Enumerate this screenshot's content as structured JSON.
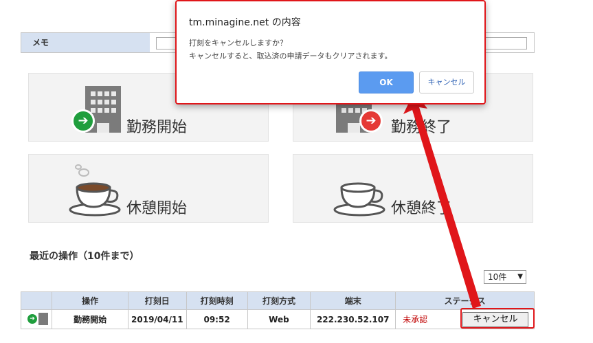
{
  "memo": {
    "label": "メモ",
    "value": ""
  },
  "tiles": {
    "work_start": "勤務開始",
    "work_end": "勤務終了",
    "break_start": "休憩開始",
    "break_end": "休憩終了"
  },
  "recent": {
    "title": "最近の操作（10件まで）",
    "count_select": "10件",
    "columns": [
      "",
      "操作",
      "打刻日",
      "打刻時刻",
      "打刻方式",
      "端末",
      "ステータス"
    ],
    "rows": [
      {
        "operation": "勤務開始",
        "date": "2019/04/11",
        "time": "09:52",
        "method": "Web",
        "terminal": "222.230.52.107",
        "status": "未承認",
        "action_label": "キャンセル"
      }
    ]
  },
  "dialog": {
    "title": "tm.minagine.net の内容",
    "line1": "打刻をキャンセルしますか？",
    "line2": "キャンセルすると、取込済の申請データもクリアされます。",
    "ok_label": "OK",
    "cancel_label": "キャンセル"
  },
  "colors": {
    "header_bg": "#d6e1f1",
    "tile_bg": "#f3f3f3",
    "start_arrow": "#1f9e3d",
    "end_arrow": "#e53935",
    "highlight": "#e0161a",
    "ok_button": "#5b9bf0",
    "status_text": "#c00000"
  },
  "icons": {
    "work_start": "building-with-green-arrow-icon",
    "work_end": "building-with-red-arrow-icon",
    "break_start": "steaming-coffee-cup-icon",
    "break_end": "coffee-cup-icon"
  }
}
